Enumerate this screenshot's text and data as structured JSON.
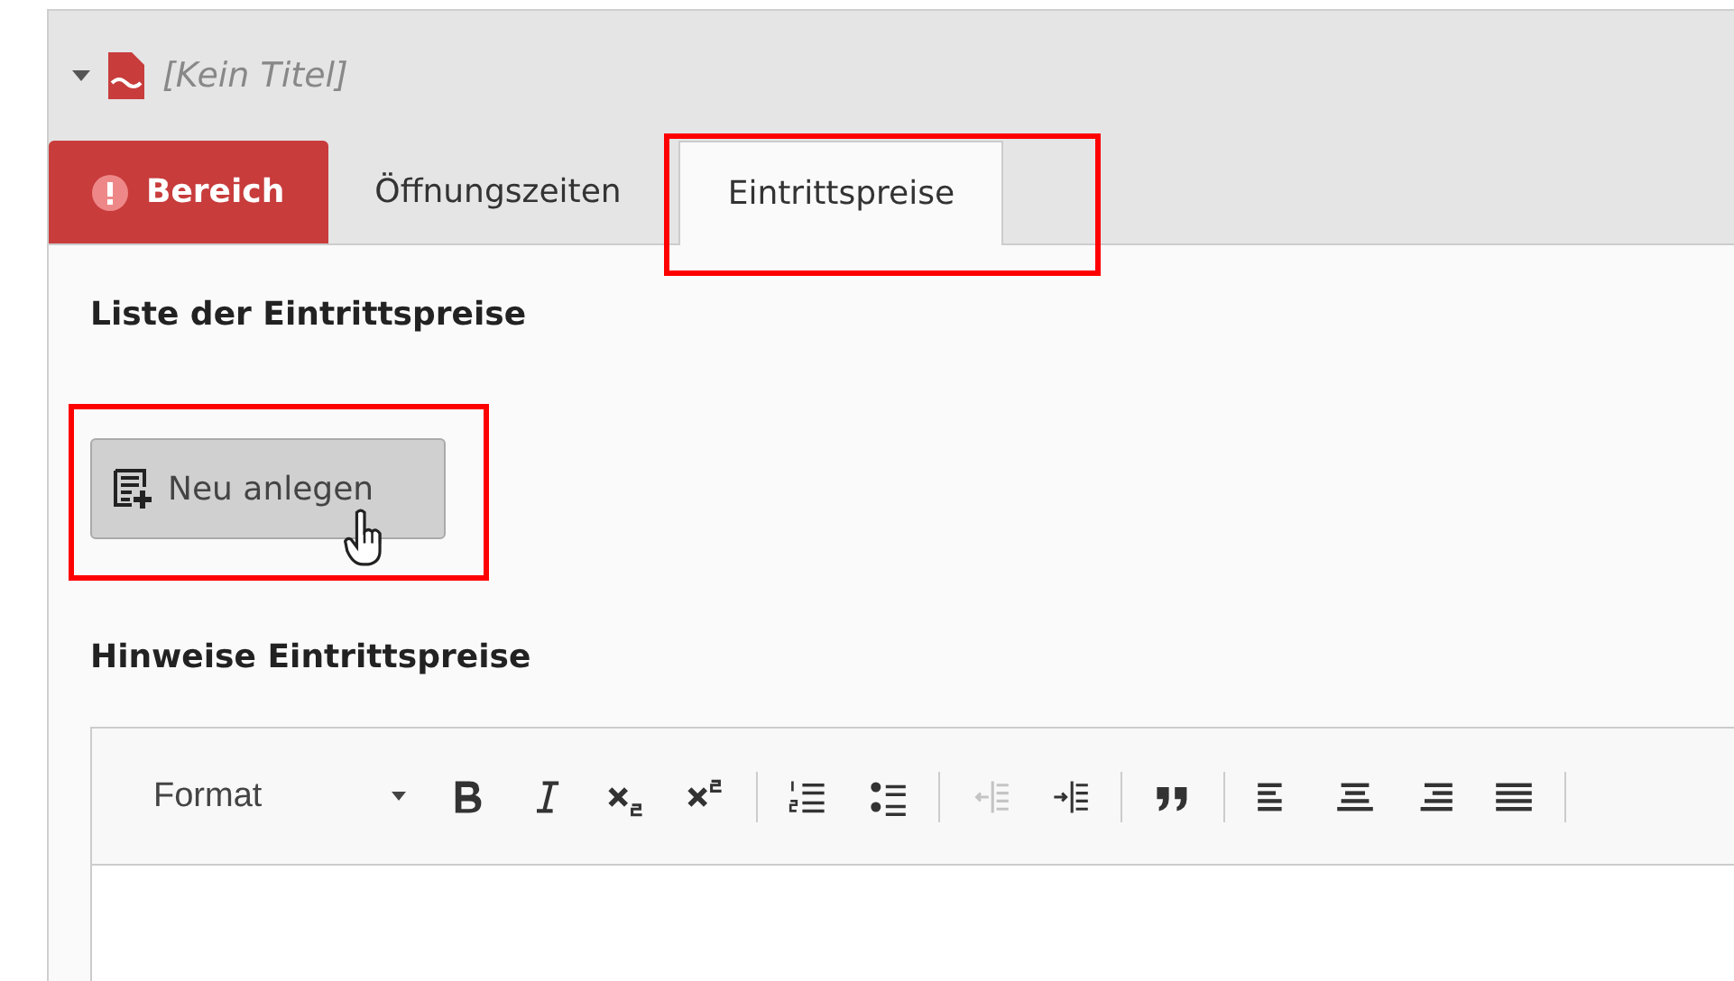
{
  "record": {
    "title": "[Kein Titel]",
    "expanded": true
  },
  "tabs": [
    {
      "label": "Bereich",
      "selected": false,
      "error": true,
      "highlighted": false
    },
    {
      "label": "Öffnungszeiten",
      "selected": false,
      "error": false,
      "highlighted": false
    },
    {
      "label": "Eintrittspreise",
      "selected": true,
      "error": false,
      "highlighted": true
    }
  ],
  "section_title": "Liste der Eintrittspreise",
  "new_button": {
    "label": "Neu anlegen",
    "highlighted": true
  },
  "notes_title": "Hinweise Eintrittspreise",
  "editor": {
    "format_label": "Format",
    "tools": [
      {
        "kind": "bold",
        "disabled": false
      },
      {
        "kind": "italic",
        "disabled": false
      },
      {
        "kind": "subscript",
        "disabled": false
      },
      {
        "kind": "superscript",
        "disabled": false
      },
      {
        "kind": "sep"
      },
      {
        "kind": "numbered-list",
        "disabled": false
      },
      {
        "kind": "bullet-list",
        "disabled": false
      },
      {
        "kind": "sep"
      },
      {
        "kind": "outdent",
        "disabled": true
      },
      {
        "kind": "indent",
        "disabled": false
      },
      {
        "kind": "sep"
      },
      {
        "kind": "quote",
        "disabled": false
      },
      {
        "kind": "sep"
      },
      {
        "kind": "align-left",
        "disabled": false
      },
      {
        "kind": "align-center",
        "disabled": false
      },
      {
        "kind": "align-right",
        "disabled": false
      },
      {
        "kind": "justify",
        "disabled": false
      },
      {
        "kind": "sep"
      }
    ]
  }
}
